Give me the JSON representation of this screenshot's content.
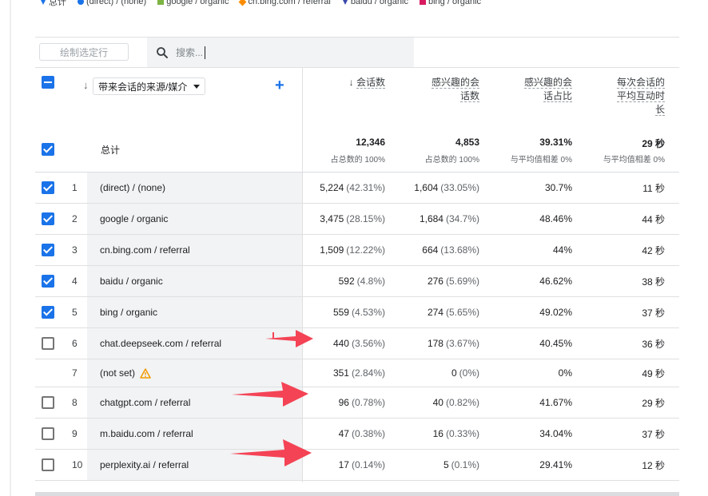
{
  "legend": [
    {
      "label": "总计",
      "color": "#1a73e8",
      "shape": "triangle"
    },
    {
      "label": "(direct) / (none)",
      "color": "#1a73e8",
      "shape": "dot"
    },
    {
      "label": "google / organic",
      "color": "#7cb342",
      "shape": "square"
    },
    {
      "label": "cn.bing.com / referral",
      "color": "#fb8c00",
      "shape": "diamond"
    },
    {
      "label": "baidu / organic",
      "color": "#3949ab",
      "shape": "triangle"
    },
    {
      "label": "bing / organic",
      "color": "#d81b60",
      "shape": "square"
    }
  ],
  "toolbar": {
    "plot_rows_label": "绘制选定行",
    "search_placeholder": "搜索..."
  },
  "header": {
    "dimension_label": "带来会话的来源/媒介",
    "metric1": "会话数",
    "metric2_line1": "感兴趣的会",
    "metric2_line2": "话数",
    "metric3_line1": "感兴趣的会",
    "metric3_line2": "话占比",
    "metric4_line1": "每次会话的",
    "metric4_line2": "平均互动时",
    "metric4_line3": "长"
  },
  "totals": {
    "label": "总计",
    "m1": "12,346",
    "m1_sub": "占总数的 100%",
    "m2": "4,853",
    "m2_sub": "占总数的 100%",
    "m3": "39.31%",
    "m3_sub": "与平均值相差 0%",
    "m4": "29 秒",
    "m4_sub": "与平均值相差 0%"
  },
  "rows": [
    {
      "num": "1",
      "name": "(direct) / (none)",
      "checked": "yes",
      "m1": "5,224",
      "m1p": "(42.31%)",
      "m2": "1,604",
      "m2p": "(33.05%)",
      "m3": "30.7%",
      "m4": "11 秒"
    },
    {
      "num": "2",
      "name": "google / organic",
      "checked": "yes",
      "m1": "3,475",
      "m1p": "(28.15%)",
      "m2": "1,684",
      "m2p": "(34.7%)",
      "m3": "48.46%",
      "m4": "44 秒"
    },
    {
      "num": "3",
      "name": "cn.bing.com / referral",
      "checked": "yes",
      "m1": "1,509",
      "m1p": "(12.22%)",
      "m2": "664",
      "m2p": "(13.68%)",
      "m3": "44%",
      "m4": "42 秒"
    },
    {
      "num": "4",
      "name": "baidu / organic",
      "checked": "yes",
      "m1": "592",
      "m1p": "(4.8%)",
      "m2": "276",
      "m2p": "(5.69%)",
      "m3": "46.62%",
      "m4": "38 秒"
    },
    {
      "num": "5",
      "name": "bing / organic",
      "checked": "yes",
      "m1": "559",
      "m1p": "(4.53%)",
      "m2": "274",
      "m2p": "(5.65%)",
      "m3": "49.02%",
      "m4": "37 秒"
    },
    {
      "num": "6",
      "name": "chat.deepseek.com / referral",
      "checked": "no",
      "m1": "440",
      "m1p": "(3.56%)",
      "m2": "178",
      "m2p": "(3.67%)",
      "m3": "40.45%",
      "m4": "36 秒"
    },
    {
      "num": "7",
      "name": "(not set)",
      "checked": "none",
      "m1": "351",
      "m1p": "(2.84%)",
      "m2": "0",
      "m2p": "(0%)",
      "m3": "0%",
      "m4": "49 秒"
    },
    {
      "num": "8",
      "name": "chatgpt.com / referral",
      "checked": "no",
      "m1": "96",
      "m1p": "(0.78%)",
      "m2": "40",
      "m2p": "(0.82%)",
      "m3": "41.67%",
      "m4": "29 秒"
    },
    {
      "num": "9",
      "name": "m.baidu.com / referral",
      "checked": "no",
      "m1": "47",
      "m1p": "(0.38%)",
      "m2": "16",
      "m2p": "(0.33%)",
      "m3": "34.04%",
      "m4": "37 秒"
    },
    {
      "num": "10",
      "name": "perplexity.ai / referral",
      "checked": "no",
      "m1": "17",
      "m1p": "(0.14%)",
      "m2": "5",
      "m2p": "(0.1%)",
      "m3": "29.41%",
      "m4": "12 秒"
    }
  ],
  "colors": {
    "accent": "#1a73e8",
    "arrow": "#f44355",
    "warning": "#f29900"
  }
}
